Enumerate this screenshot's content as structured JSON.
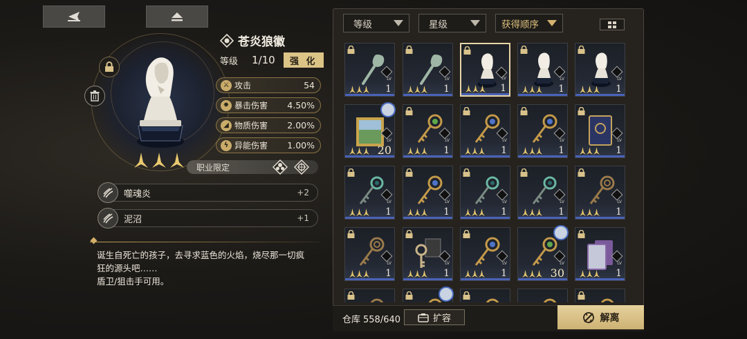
{
  "nav": {
    "back_icon": "back-arrow-icon",
    "eject_icon": "eject-icon"
  },
  "item": {
    "name": "苍炎狼徽",
    "level_label": "等级",
    "level_value": "1/10",
    "enhance_label": "强 化",
    "stats": [
      {
        "label": "攻击",
        "value": "54"
      },
      {
        "label": "暴击伤害",
        "value": "4.50%"
      },
      {
        "label": "物质伤害",
        "value": "2.00%"
      },
      {
        "label": "异能伤害",
        "value": "1.00%"
      }
    ],
    "star_count": 3,
    "class_restriction_label": "职业限定",
    "skills": [
      {
        "name": "噬魂炎",
        "value": "+2"
      },
      {
        "name": "泥沼",
        "value": "+1"
      }
    ],
    "description": [
      "诞生自死亡的孩子，去寻求蓝色的火焰，烧尽那一切疯",
      "狂的源头吧……",
      "盾卫/狙击手可用。"
    ]
  },
  "inventory": {
    "filters": [
      {
        "label": "等级",
        "active": false
      },
      {
        "label": "星级",
        "active": false
      },
      {
        "label": "获得顺序",
        "active": true
      }
    ],
    "view_toggle_icon": "grid-view-icon",
    "level_tag": "LV",
    "slots": [
      {
        "type": "spoon",
        "lv": "1",
        "locked": true
      },
      {
        "type": "spoon",
        "lv": "1",
        "locked": true
      },
      {
        "type": "chess",
        "lv": "1",
        "locked": true,
        "selected": true
      },
      {
        "type": "chess",
        "lv": "1",
        "locked": true
      },
      {
        "type": "chess",
        "lv": "1",
        "locked": true
      },
      {
        "type": "painting",
        "lv": "20",
        "locked": false,
        "avatar": true
      },
      {
        "type": "key-green",
        "lv": "1",
        "locked": true
      },
      {
        "type": "key-blue",
        "lv": "1",
        "locked": true
      },
      {
        "type": "key-blue",
        "lv": "1",
        "locked": true
      },
      {
        "type": "card",
        "lv": "1",
        "locked": true
      },
      {
        "type": "key-teal",
        "lv": "1",
        "locked": true
      },
      {
        "type": "key-blue",
        "lv": "1",
        "locked": true
      },
      {
        "type": "key-teal",
        "lv": "1",
        "locked": true
      },
      {
        "type": "key-teal",
        "lv": "1",
        "locked": true
      },
      {
        "type": "key-bronze",
        "lv": "1",
        "locked": true
      },
      {
        "type": "key-bronze",
        "lv": "1",
        "locked": true
      },
      {
        "type": "tag-key",
        "lv": "1",
        "locked": true
      },
      {
        "type": "key-blue",
        "lv": "1",
        "locked": true
      },
      {
        "type": "key-green",
        "lv": "30",
        "locked": false,
        "avatar": true
      },
      {
        "type": "cards",
        "lv": "1",
        "locked": true
      },
      {
        "type": "key-bronze",
        "lv": "",
        "locked": true
      },
      {
        "type": "key-blue",
        "lv": "",
        "locked": true,
        "avatar": true
      },
      {
        "type": "key-blue",
        "lv": "",
        "locked": true
      },
      {
        "type": "key-blue",
        "lv": "",
        "locked": false
      },
      {
        "type": "key-blue",
        "lv": "",
        "locked": true
      }
    ],
    "storage_label": "仓库",
    "storage_value": "558/640",
    "expand_label": "扩容",
    "dismantle_label": "解离"
  },
  "colors": {
    "accent_gold": "#dcc487",
    "lv_bar_blue": "#4a63b8",
    "panel_bg": "#26231f"
  }
}
